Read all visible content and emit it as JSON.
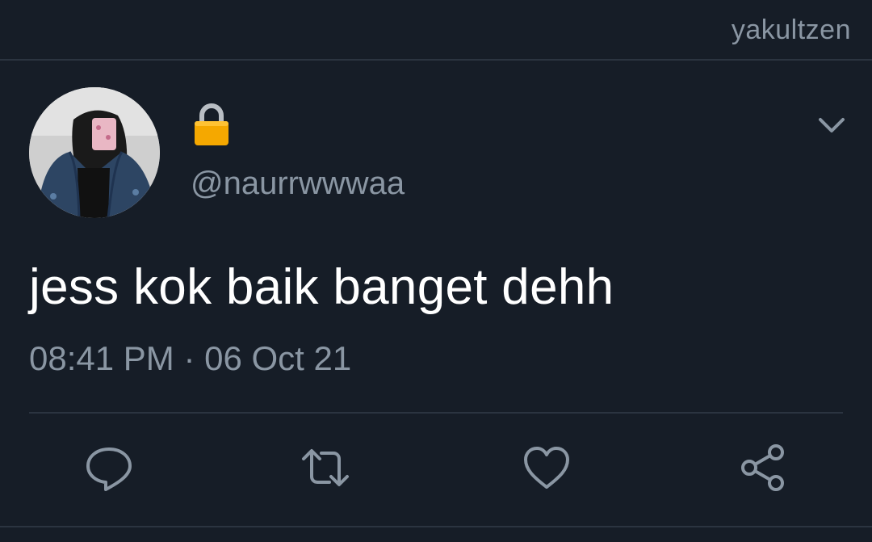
{
  "header": {
    "username": "yakultzen"
  },
  "tweet": {
    "handle": "@naurrwwwaa",
    "text": "jess kok baik banget dehh",
    "timestamp": "08:41 PM · 06 Oct 21"
  },
  "icons": {
    "lock": "lock-icon",
    "more": "chevron-down-icon",
    "reply": "reply-icon",
    "retweet": "retweet-icon",
    "like": "heart-icon",
    "share": "share-icon"
  },
  "colors": {
    "background": "#161d27",
    "muted_text": "#8a96a3",
    "primary_text": "#ffffff",
    "divider": "#2b3440",
    "lock": "#f5a800"
  }
}
